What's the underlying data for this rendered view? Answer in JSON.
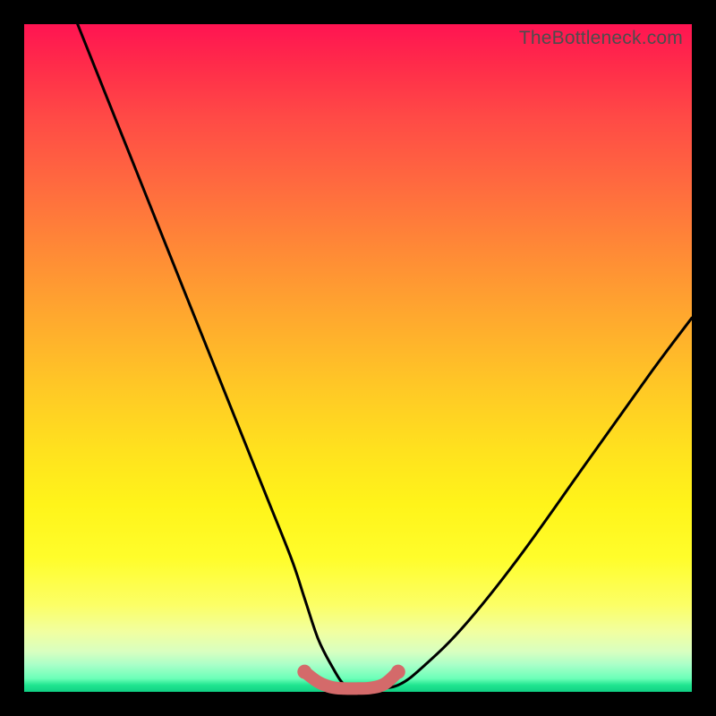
{
  "watermark": "TheBottleneck.com",
  "chart_data": {
    "type": "line",
    "title": "",
    "xlabel": "",
    "ylabel": "",
    "xlim": [
      0,
      100
    ],
    "ylim": [
      0,
      100
    ],
    "grid": false,
    "legend": false,
    "series": [
      {
        "name": "bottleneck-curve",
        "color": "#000000",
        "x": [
          8,
          12,
          16,
          20,
          24,
          28,
          32,
          36,
          40,
          42,
          44,
          46,
          48,
          50,
          52,
          56,
          60,
          66,
          74,
          84,
          94,
          100
        ],
        "y": [
          100,
          90,
          80,
          70,
          60,
          50,
          40,
          30,
          20,
          14,
          8,
          4,
          1,
          0.5,
          0.5,
          1,
          4,
          10,
          20,
          34,
          48,
          56
        ]
      },
      {
        "name": "bottom-marker-band",
        "color": "#d46a6a",
        "x": [
          42,
          44,
          46,
          48,
          50,
          52,
          54,
          56
        ],
        "y": [
          3,
          1.5,
          0.7,
          0.5,
          0.5,
          0.6,
          1.2,
          3
        ]
      }
    ],
    "annotations": []
  },
  "colors": {
    "frame": "#000000",
    "curve_stroke": "#000000",
    "marker_stroke": "#d46a6a"
  }
}
